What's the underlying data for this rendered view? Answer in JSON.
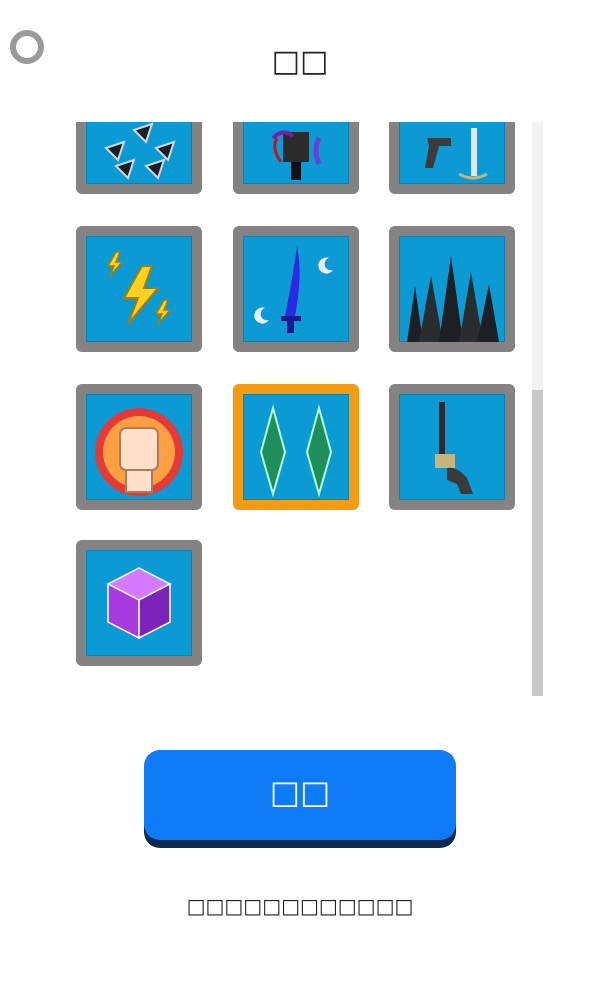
{
  "header": {
    "title": "□□",
    "back_icon": "back-circle-icon"
  },
  "grid": {
    "tiles": [
      {
        "icon": "shuriken-icon",
        "selected": false
      },
      {
        "icon": "dark-blade-icon",
        "selected": false
      },
      {
        "icon": "flintlock-and-sword-icon",
        "selected": false
      },
      {
        "icon": "lightning-icon",
        "selected": false
      },
      {
        "icon": "moon-sword-icon",
        "selected": false
      },
      {
        "icon": "black-spikes-icon",
        "selected": false
      },
      {
        "icon": "fist-icon",
        "selected": false
      },
      {
        "icon": "green-crystal-blades-icon",
        "selected": true
      },
      {
        "icon": "revolver-icon",
        "selected": false
      },
      {
        "icon": "purple-cube-icon",
        "selected": false
      }
    ]
  },
  "primary_button": {
    "label": "□□"
  },
  "footer": {
    "note": "□□□□□□□□□□□□"
  },
  "colors": {
    "tile_bg": "#0b9ad3",
    "tile_border": "#858381",
    "selected_border": "#f39c12",
    "button": "#0f7cf7"
  }
}
